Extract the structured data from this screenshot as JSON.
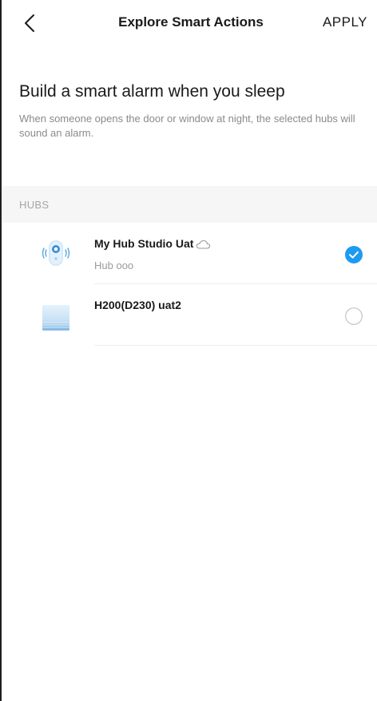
{
  "header": {
    "back_icon": "chevron-left-icon",
    "title": "Explore Smart Actions",
    "apply_label": "APPLY"
  },
  "intro": {
    "title": "Build a smart alarm when you sleep",
    "description": "When someone opens the door or window at night, the selected hubs will sound an alarm."
  },
  "section": {
    "label": "HUBS"
  },
  "hubs": [
    {
      "name": "My Hub Studio Uat",
      "subtitle": "Hub ooo",
      "icon": "hub-device-icon",
      "cloud": true,
      "selected": true
    },
    {
      "name": "H200(D230) uat2",
      "subtitle": "",
      "icon": "h200-device-icon",
      "cloud": false,
      "selected": false
    }
  ],
  "colors": {
    "accent": "#1d9bf0",
    "text_primary": "#1a1a1a",
    "text_secondary": "#8a8a8a",
    "section_bg": "#f6f6f6",
    "divider": "#ececec"
  }
}
